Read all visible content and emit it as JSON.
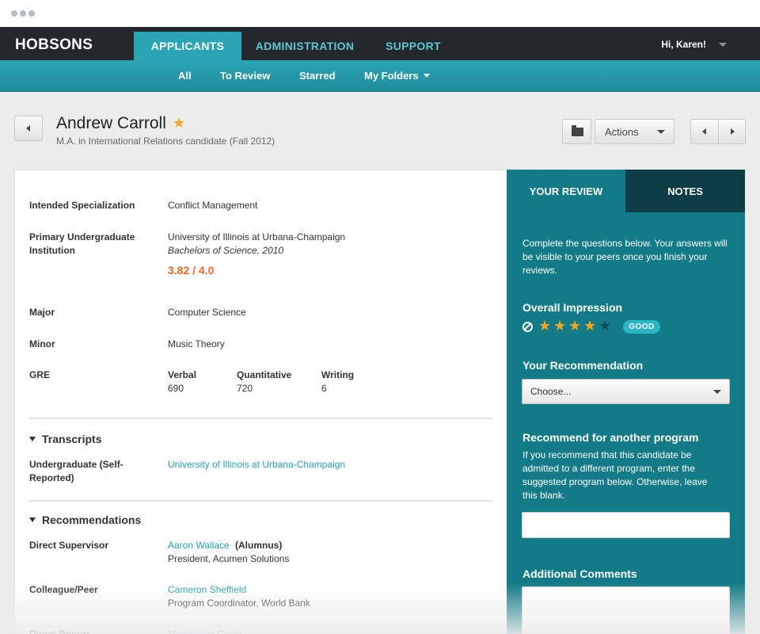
{
  "nav": {
    "brand": "HOBSONS",
    "tabs": [
      {
        "label": "APPLICANTS",
        "active": true
      },
      {
        "label": "ADMINISTRATION",
        "active": false
      },
      {
        "label": "SUPPORT",
        "active": false
      }
    ],
    "greeting": "Hi, Karen!",
    "subnav": [
      "All",
      "To Review",
      "Starred",
      "My Folders"
    ]
  },
  "applicant": {
    "name": "Andrew Carroll",
    "starred": true,
    "star_glyph": "★",
    "program": "M.A. in International Relations candidate (Fall 2012)"
  },
  "toolbar": {
    "actions_label": "Actions"
  },
  "details": {
    "specialization_label": "Intended Specialization",
    "specialization": "Conflict Management",
    "institution_label": "Primary Undergraduate Institution",
    "institution": "University of Illinois at Urbana-Champaign",
    "degree": "Bachelors of Science, 2010",
    "gpa": "3.82 / 4.0",
    "major_label": "Major",
    "major": "Computer Science",
    "minor_label": "Minor",
    "minor": "Music Theory",
    "gre_label": "GRE",
    "gre": [
      {
        "label": "Verbal",
        "score": "690"
      },
      {
        "label": "Quantitative",
        "score": "720"
      },
      {
        "label": "Writing",
        "score": "6"
      }
    ]
  },
  "transcripts": {
    "title": "Transcripts",
    "rows": [
      {
        "label": "Undergraduate (Self-Reported)",
        "value": "University of Illinois at Urbana-Champaign"
      }
    ]
  },
  "recommendations": {
    "title": "Recommendations",
    "rows": [
      {
        "label": "Direct Supervisor",
        "name": "Aaron Wallace",
        "note": "(Alumnus)",
        "title": "President, Acumen Solutions"
      },
      {
        "label": "Colleague/Peer",
        "name": "Cameron Sheffield",
        "note": "",
        "title": "Program Coordinator, World Bank"
      },
      {
        "label": "Direct Report",
        "name": "Maximillian Colby",
        "note": "",
        "title": ""
      }
    ]
  },
  "review": {
    "tabs": [
      "YOUR REVIEW",
      "NOTES"
    ],
    "intro": "Complete the questions below. Your answers will be visible to your peers once you finish your reviews.",
    "impression_title": "Overall Impression",
    "rating": 4,
    "rating_max": 5,
    "rating_label": "GOOD",
    "recommendation_title": "Your Recommendation",
    "recommendation_value": "Choose...",
    "other_program_title": "Recommend for another program",
    "other_program_help": "If you recommend that this candidate be admitted to a different program, enter the suggested program below. Otherwise, leave this blank.",
    "comments_title": "Additional Comments"
  },
  "colors": {
    "accent": "#2ba5b5",
    "panel": "#137a87",
    "gpa": "#f26522",
    "star": "#f5a623",
    "link": "#26a3b5"
  },
  "icons": [
    "back-icon",
    "star-icon",
    "folder-icon",
    "chevron-down-icon",
    "prev-icon",
    "next-icon",
    "clear-rating-icon",
    "triangle-down-icon"
  ]
}
